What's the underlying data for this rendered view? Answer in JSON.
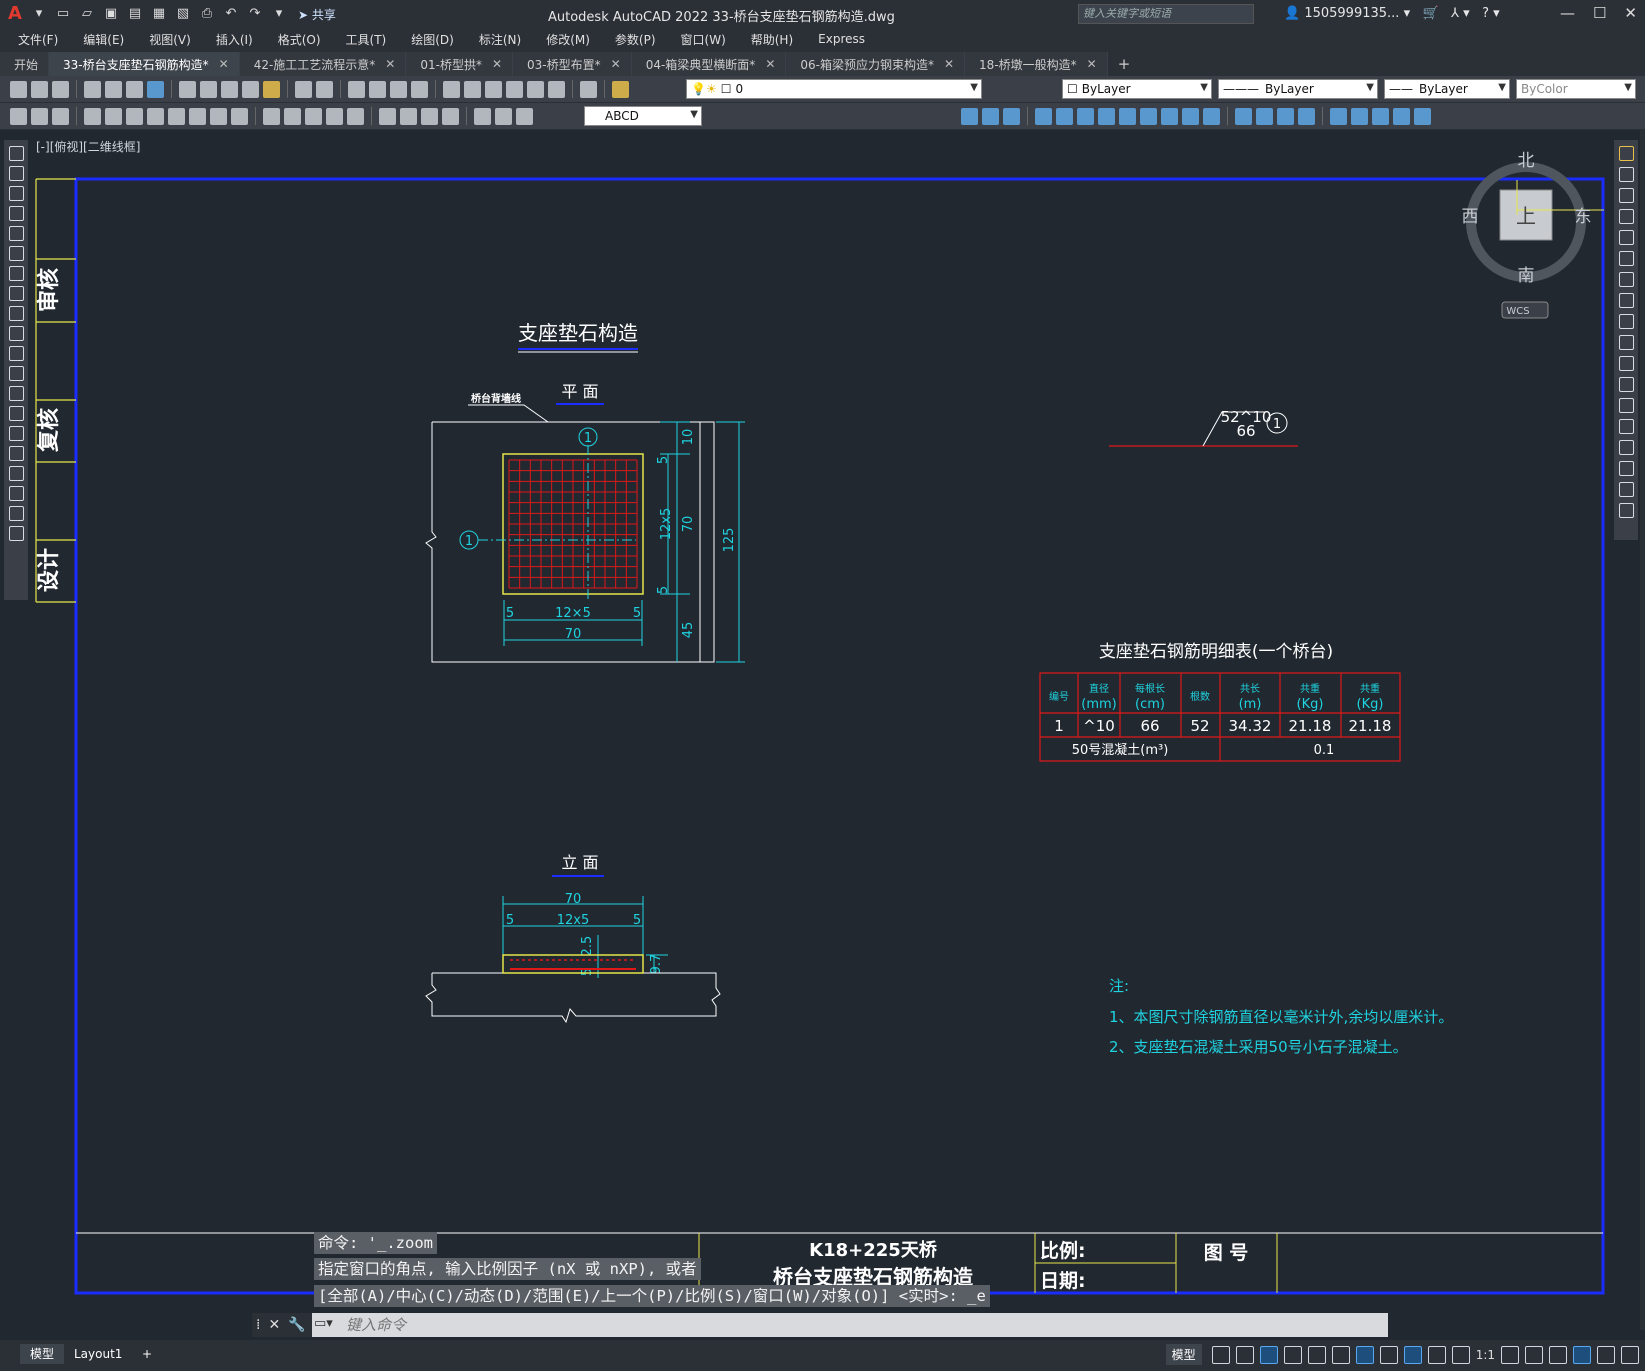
{
  "app": {
    "title": "Autodesk AutoCAD 2022    33-桥台支座垫石钢筋构造.dwg",
    "share_label": "共享",
    "search_placeholder": "键入关键字或短语",
    "user": "1505999135...",
    "logo": "A"
  },
  "menu": [
    "文件(F)",
    "编辑(E)",
    "视图(V)",
    "插入(I)",
    "格式(O)",
    "工具(T)",
    "绘图(D)",
    "标注(N)",
    "修改(M)",
    "参数(P)",
    "窗口(W)",
    "帮助(H)",
    "Express"
  ],
  "tabs": [
    {
      "label": "开始",
      "active": false,
      "closable": false
    },
    {
      "label": "33-桥台支座垫石钢筋构造*",
      "active": true,
      "closable": true
    },
    {
      "label": "42-施工工艺流程示意*",
      "active": false,
      "closable": true
    },
    {
      "label": "01-桥型拱*",
      "active": false,
      "closable": true
    },
    {
      "label": "03-桥型布置*",
      "active": false,
      "closable": true
    },
    {
      "label": "04-箱梁典型横断面*",
      "active": false,
      "closable": true
    },
    {
      "label": "06-箱梁预应力钢束构造*",
      "active": false,
      "closable": true
    },
    {
      "label": "18-桥墩一般构造*",
      "active": false,
      "closable": true
    }
  ],
  "toolbar": {
    "layer_value": "0",
    "color_value": "ByLayer",
    "linetype_value": "ByLayer",
    "lineweight_value": "ByLayer",
    "plotstyle_value": "ByColor",
    "textstyle_value": "ABCD"
  },
  "viewport_label": "[-][俯视][二维线框]",
  "viewcube": {
    "north": "北",
    "south": "南",
    "east": "东",
    "west": "西",
    "face": "上",
    "wcs": "WCS"
  },
  "side_labels": [
    "审核",
    "复核",
    "设计"
  ],
  "drawing": {
    "main_title": "支座垫石构造",
    "plan_title": "平 面",
    "elevation_title": "立 面",
    "plan_note": "桥台背墙线",
    "callout_num": "1",
    "bar_label_top": "52^10",
    "bar_label_bottom": "66",
    "plan_dims": {
      "top": "10",
      "five_top": "5",
      "mid_grid": "12x5",
      "mid": "70",
      "five_bot": "5",
      "total": "125",
      "bottom": "45",
      "h_five_l": "5",
      "h_grid": "12×5",
      "h_five_r": "5",
      "h_total": "70"
    },
    "elev_dims": {
      "total": "70",
      "grid": "12x5",
      "five_l": "5",
      "five_r": "5",
      "v_top": "2.5",
      "v_bot": "5",
      "h": "9.7"
    },
    "table": {
      "title": "支座垫石钢筋明细表(一个桥台)",
      "headers": [
        [
          "编号",
          ""
        ],
        [
          "直径",
          "(mm)"
        ],
        [
          "每根长",
          "(cm)"
        ],
        [
          "根数",
          ""
        ],
        [
          "共长",
          "(m)"
        ],
        [
          "共重",
          "(Kg)"
        ],
        [
          "共重",
          "(Kg)"
        ]
      ],
      "row": [
        "1",
        "^10",
        "66",
        "52",
        "34.32",
        "21.18",
        "21.18"
      ],
      "concrete_label": "50号混凝土(m³)",
      "concrete_value": "0.1"
    },
    "notes": {
      "title": "注:",
      "items": [
        "1、本图尺寸除钢筋直径以毫米计外,余均以厘米计。",
        "2、支座垫石混凝土采用50号小石子混凝土。"
      ]
    },
    "titleblock": {
      "project": "K18+225天桥",
      "name": "桥台支座垫石钢筋构造",
      "scale_label": "比例:",
      "date_label": "日期:",
      "drawing_no_label": "图 号"
    }
  },
  "command": {
    "history": [
      "命令: '_.zoom",
      "指定窗口的角点, 输入比例因子 (nX 或 nXP), 或者",
      "[全部(A)/中心(C)/动态(D)/范围(E)/上一个(P)/比例(S)/窗口(W)/对象(O)] <实时>: _e"
    ],
    "placeholder": "键入命令"
  },
  "layout_tabs": [
    "模型",
    "Layout1"
  ],
  "status": {
    "model": "模型",
    "scale": "1:1"
  },
  "colors": {
    "background": "#212830",
    "border_blue": "#1a2cff",
    "cyan": "#1fd3e0",
    "yellow": "#e6e64a",
    "red": "#e01818"
  }
}
